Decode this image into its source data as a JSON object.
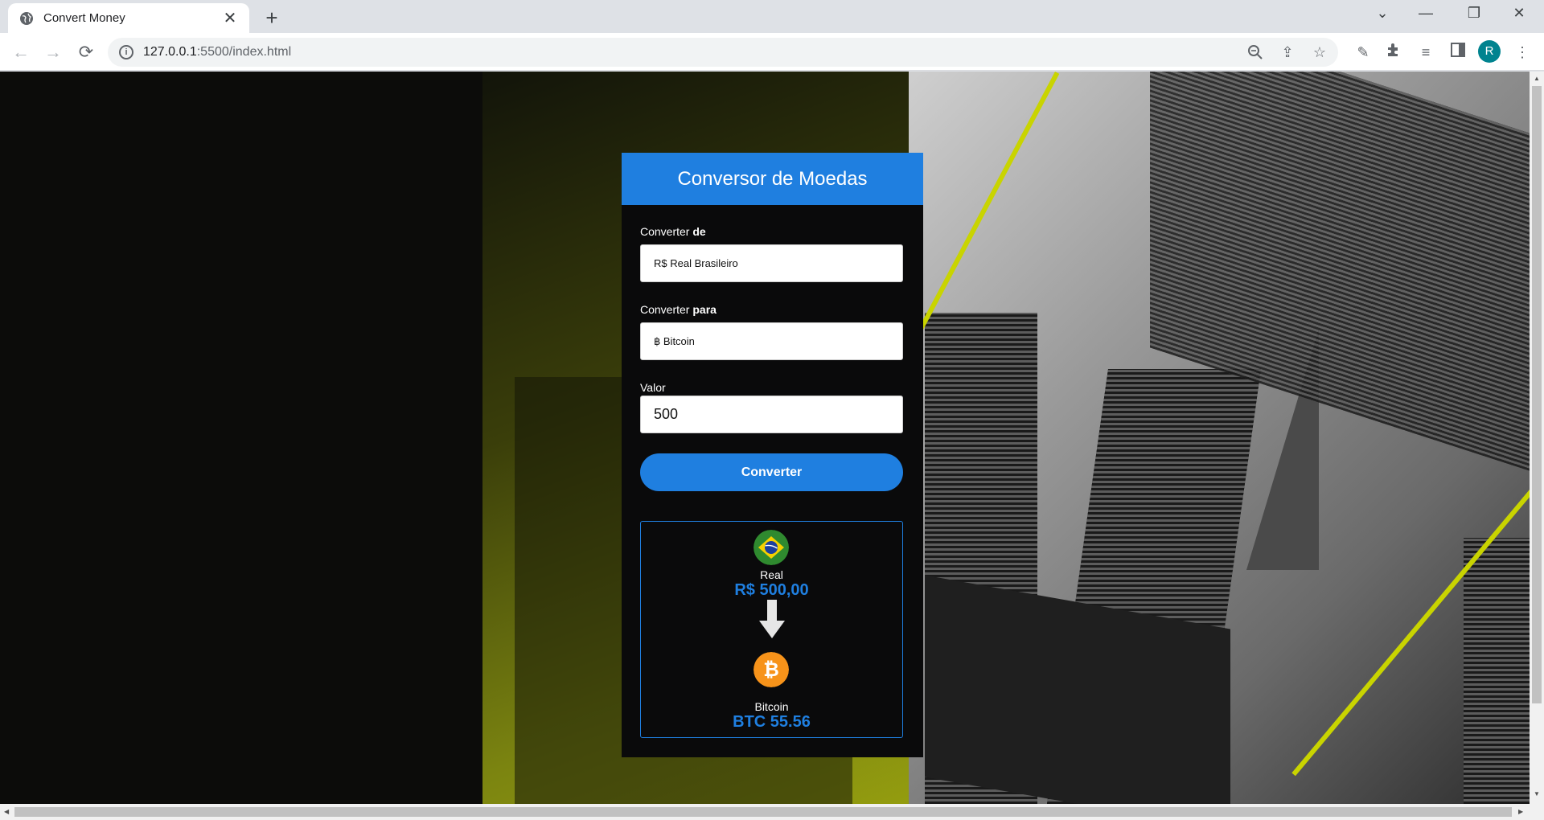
{
  "browser": {
    "tab_title": "Convert Money",
    "url_host": "127.0.0.1",
    "url_rest": ":5500/index.html",
    "profile_initial": "R"
  },
  "converter": {
    "title": "Conversor de Moedas",
    "from_label_prefix": "Converter ",
    "from_label_bold": "de",
    "from_value": "R$ Real Brasileiro",
    "to_label_prefix": "Converter ",
    "to_label_bold": "para",
    "to_value": "฿ Bitcoin",
    "amount_label": "Valor",
    "amount_value": "500",
    "button_label": "Converter",
    "result": {
      "from_name": "Real",
      "from_value": "R$ 500,00",
      "to_name": "Bitcoin",
      "to_value": "BTC 55.56"
    }
  },
  "colors": {
    "accent": "#1f7fe0",
    "stripe": "#c9d400",
    "card_bg": "#0a0a0b"
  }
}
